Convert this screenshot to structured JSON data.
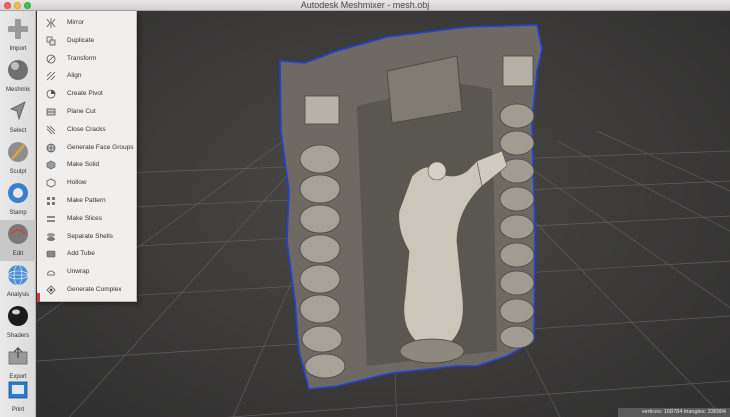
{
  "window": {
    "title": "Autodesk Meshmixer - mesh.obj"
  },
  "toolbar": {
    "items": [
      {
        "label": "Import",
        "icon": "plus-icon"
      },
      {
        "label": "Meshmix",
        "icon": "sphere-icon"
      },
      {
        "label": "Select",
        "icon": "arrow-cursor-icon"
      },
      {
        "label": "Sculpt",
        "icon": "brush-icon"
      },
      {
        "label": "Stamp",
        "icon": "stamp-icon"
      },
      {
        "label": "Edit",
        "icon": "edit-sphere-icon"
      },
      {
        "label": "Analysis",
        "icon": "wire-sphere-icon"
      },
      {
        "label": "Shaders",
        "icon": "shader-sphere-icon"
      },
      {
        "label": "Export",
        "icon": "export-icon"
      },
      {
        "label": "Print",
        "icon": "printer-icon"
      }
    ],
    "active": "Edit"
  },
  "edit_menu": {
    "items": [
      {
        "label": "Mirror",
        "icon": "mirror-icon"
      },
      {
        "label": "Duplicate",
        "icon": "duplicate-icon"
      },
      {
        "label": "Transform",
        "icon": "transform-icon"
      },
      {
        "label": "Align",
        "icon": "align-icon"
      },
      {
        "label": "Create Pivot",
        "icon": "pivot-icon"
      },
      {
        "label": "Plane Cut",
        "icon": "plane-cut-icon"
      },
      {
        "label": "Close Cracks",
        "icon": "close-cracks-icon"
      },
      {
        "label": "Generate Face Groups",
        "icon": "face-groups-icon"
      },
      {
        "label": "Make Solid",
        "icon": "make-solid-icon"
      },
      {
        "label": "Hollow",
        "icon": "hollow-icon"
      },
      {
        "label": "Make Pattern",
        "icon": "pattern-icon"
      },
      {
        "label": "Make Slices",
        "icon": "slices-icon"
      },
      {
        "label": "Separate Shells",
        "icon": "shells-icon"
      },
      {
        "label": "Add Tube",
        "icon": "tube-icon"
      },
      {
        "label": "Unwrap",
        "icon": "unwrap-icon"
      },
      {
        "label": "Generate Complex",
        "icon": "complex-icon"
      }
    ]
  },
  "status": {
    "text": "vertices: 168784  triangles: 336904"
  },
  "colors": {
    "accent": "#d63b3b",
    "selection_outline": "#2340d8",
    "viewport_bg": "#3a3939"
  }
}
